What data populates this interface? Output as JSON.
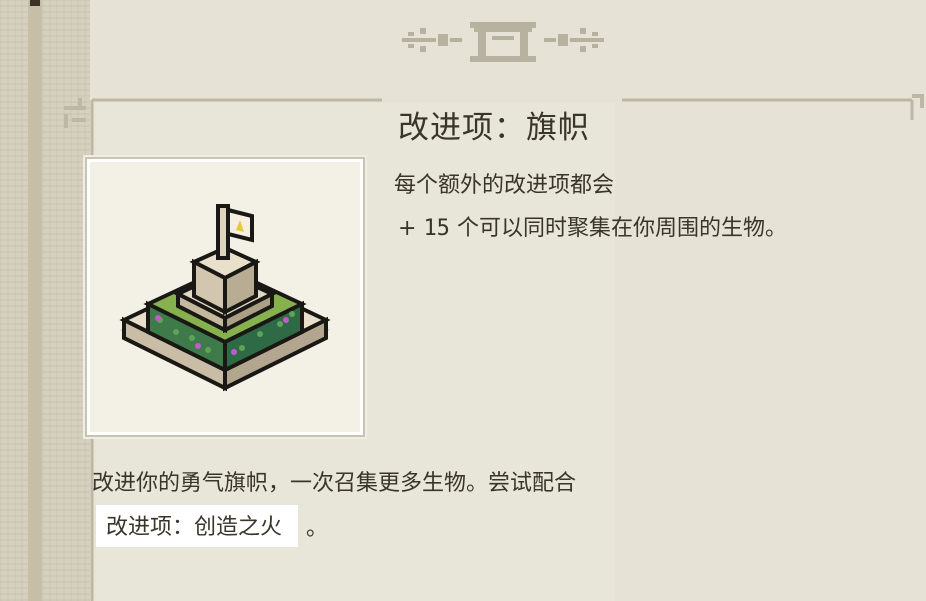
{
  "title": "改进项：旗帜",
  "description": {
    "line1": "每个额外的改进项都会",
    "bonus_prefix": "+",
    "bonus_value": "15",
    "bonus_text": "个可以同时聚集在你周围的生物。"
  },
  "body": {
    "line1": "改进你的勇气旗帜，一次召集更多生物。尝试配合",
    "link_label": "改进项：创造之火",
    "line2_end": "。"
  },
  "colors": {
    "text": "#3a342a",
    "background": "#e6e3d6",
    "frame_border": "#c9c4b1",
    "grass": "#7fa64a",
    "stone": "#ddd5c1",
    "flag_emblem": "#e8c93a"
  },
  "icons": {
    "header": "ornament-shrine-icon",
    "item": "banner-upgrade-icon"
  }
}
